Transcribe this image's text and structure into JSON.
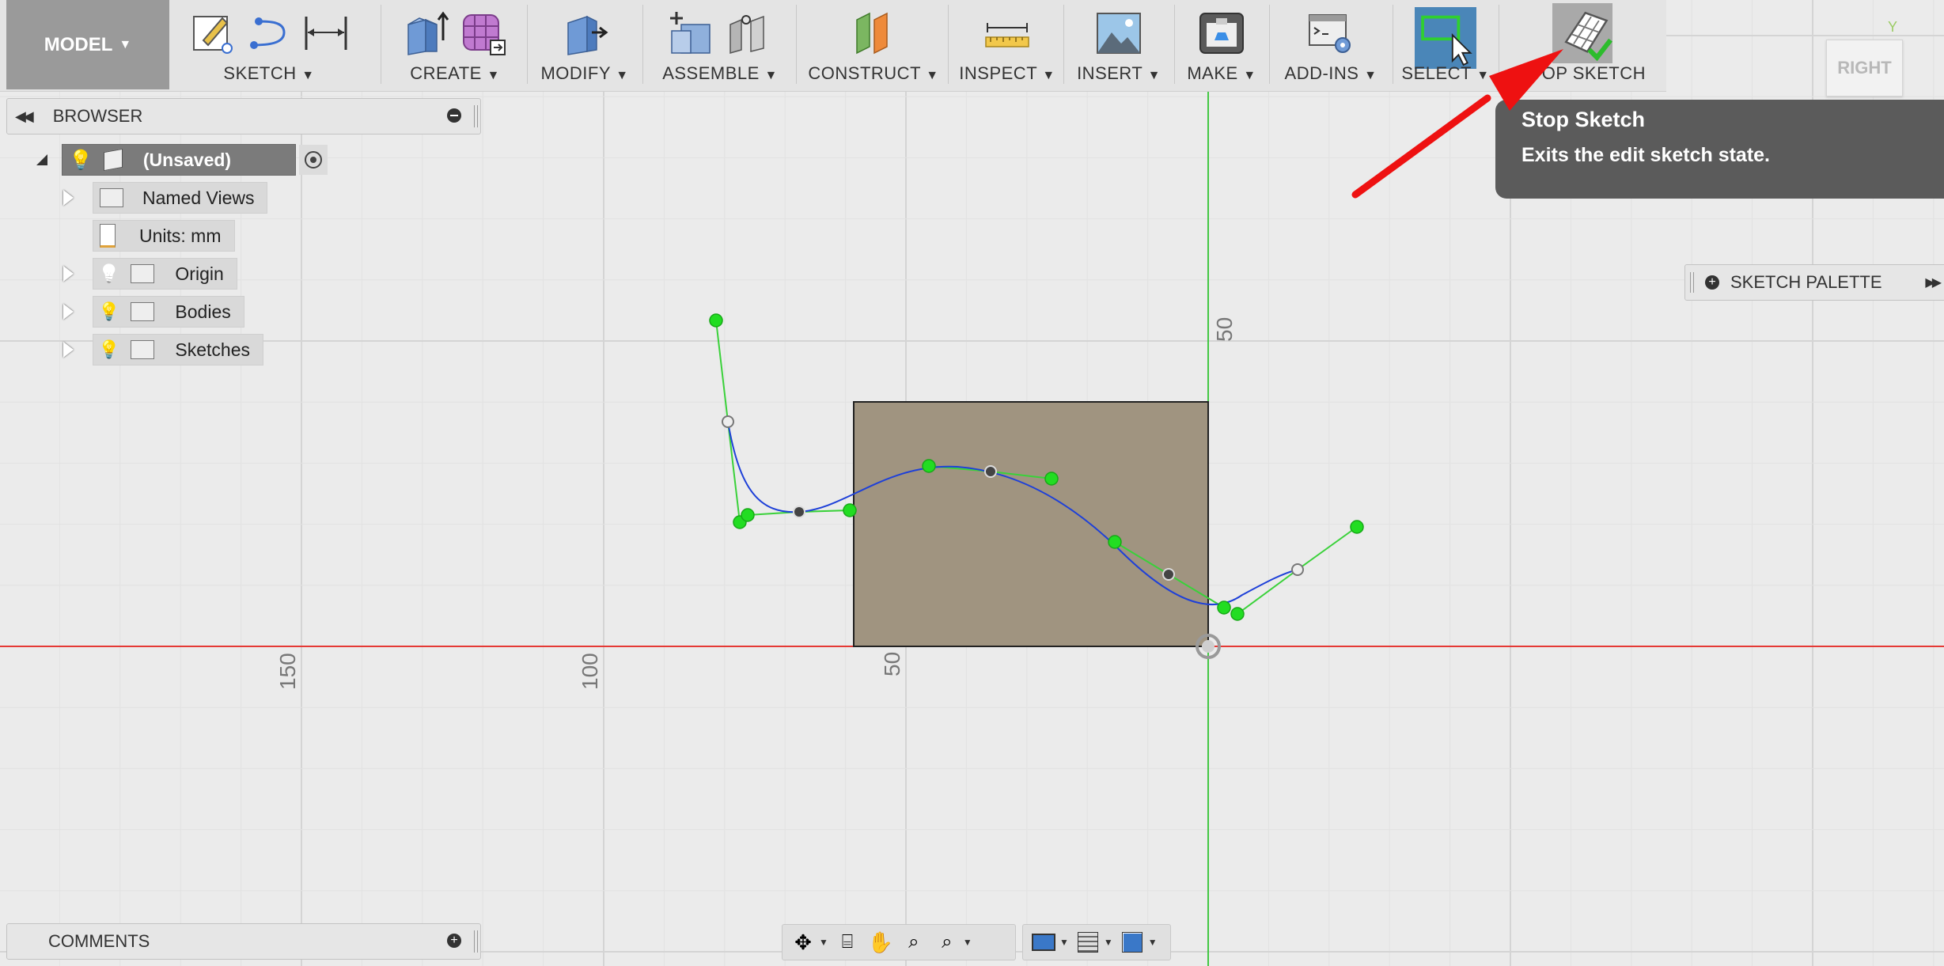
{
  "toolbar": {
    "workspace": "MODEL",
    "groups": [
      {
        "label": "SKETCH"
      },
      {
        "label": "CREATE"
      },
      {
        "label": "MODIFY"
      },
      {
        "label": "ASSEMBLE"
      },
      {
        "label": "CONSTRUCT"
      },
      {
        "label": "INSPECT"
      },
      {
        "label": "INSERT"
      },
      {
        "label": "MAKE"
      },
      {
        "label": "ADD-INS"
      },
      {
        "label": "SELECT"
      },
      {
        "label": "STOP SKETCH"
      }
    ],
    "caret": "▼"
  },
  "browser": {
    "title": "BROWSER",
    "root": "(Unsaved)",
    "items": [
      {
        "label": "Named Views",
        "icon": "folder-icon",
        "light": false,
        "expandable": true
      },
      {
        "label": "Units: mm",
        "icon": "document-icon",
        "light": false,
        "expandable": false
      },
      {
        "label": "Origin",
        "icon": "folder-icon",
        "light": true,
        "expandable": true
      },
      {
        "label": "Bodies",
        "icon": "folder-icon",
        "light": true,
        "expandable": true
      },
      {
        "label": "Sketches",
        "icon": "folder-icon",
        "light": true,
        "expandable": true
      }
    ]
  },
  "tooltip": {
    "title": "Stop Sketch",
    "description": "Exits the edit sketch state."
  },
  "palette": {
    "title": "SKETCH PALETTE"
  },
  "viewcube": {
    "face": "RIGHT",
    "axis": "Y"
  },
  "comments": {
    "title": "COMMENTS"
  },
  "canvas": {
    "x_ticks": [
      "150",
      "100",
      "50"
    ],
    "y_ticks": [
      "50"
    ]
  },
  "colors": {
    "x_axis": "#e53935",
    "y_axis": "#43c743",
    "spline": "#1e40d8",
    "control_point": "#22dd22",
    "profile_fill": "#a09480",
    "annotation_arrow": "#ee1111",
    "tooltip_bg": "#5b5b5b",
    "select_active": "#4a86b8"
  }
}
